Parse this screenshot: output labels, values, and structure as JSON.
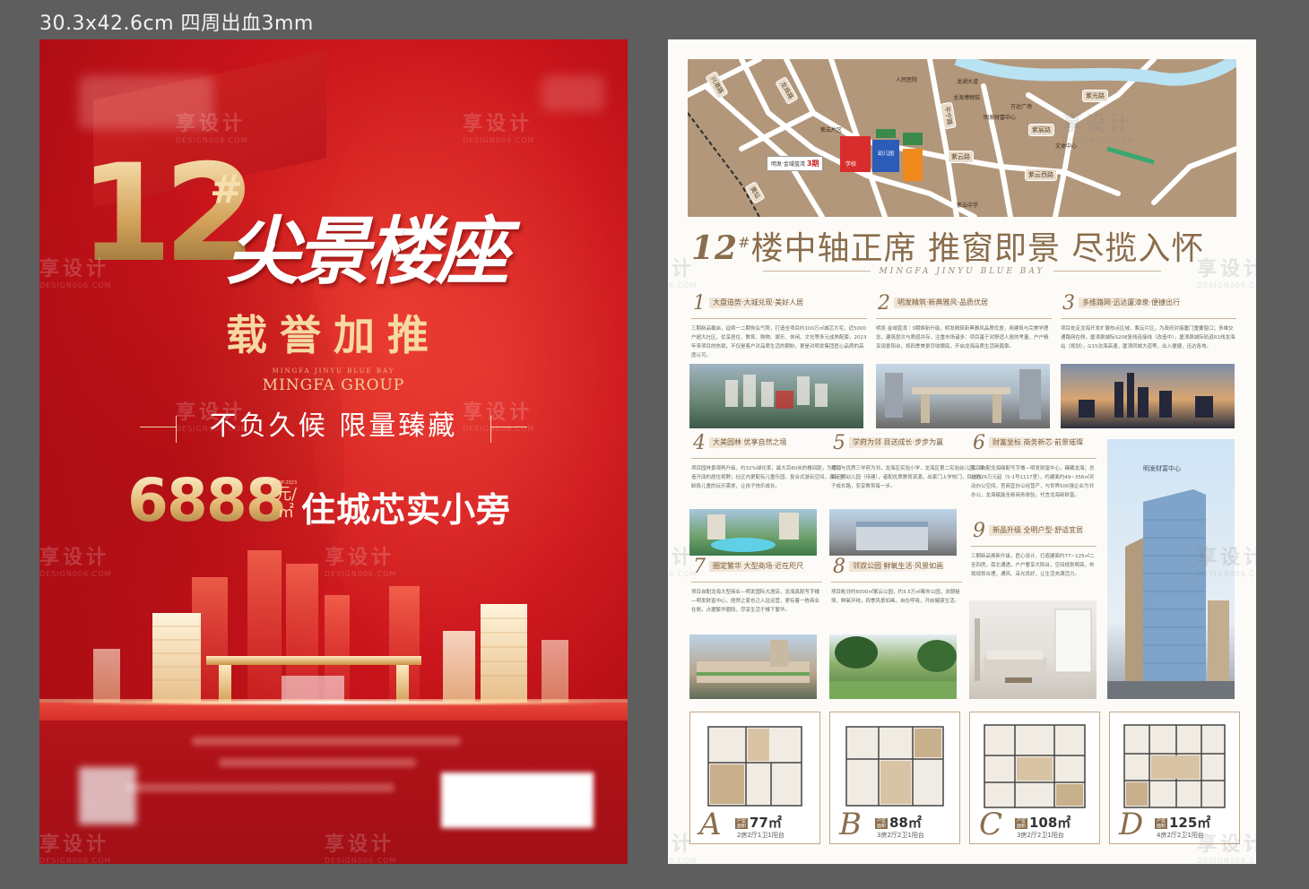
{
  "spec_label": "30.3x42.6cm 四周出血3mm",
  "watermark": {
    "cn": "享设计",
    "en": "DESIGN006.COM"
  },
  "front": {
    "big_number": "12",
    "hash": "#",
    "headline": "尖景楼座",
    "subtitle": "载誉加推",
    "brand_en_small": "MINGFA JINYU BLUE BAY",
    "brand_en": "MINGFA GROUP",
    "slogan": "不负久候  限量臻藏",
    "price": "6888",
    "price_unit": "元/㎡",
    "price_unit_small": "TOP·2023",
    "price_line": "住城芯实小旁",
    "colors": {
      "red": "#c8131a",
      "gold": "#e0b36b"
    }
  },
  "back": {
    "map": {
      "roads": [
        "兴港路",
        "龙商路",
        "平宁路",
        "紫云路",
        "紫光路",
        "紫宸路",
        "紫云西路",
        "黄坛"
      ],
      "places": [
        "紫云片区",
        "人民医院",
        "龙海博物馆",
        "明发财富中心",
        "文体中心",
        "万达广场",
        "学校",
        "龙湖大道",
        "紫云中学",
        "幼儿园",
        "明发·金域蓝湾"
      ],
      "project_label": "明发·金域蓝湾",
      "phase_label": "3期"
    },
    "headline_num": "12",
    "headline_hash": "#",
    "headline_text": "楼中轴正席 推窗即景 尽揽入怀",
    "headline_en": "MINGFA JINYU BLUE BAY",
    "features": [
      {
        "num": "1",
        "title": "大盘造势·大城兑现·美好人居",
        "body": "三期新品载启，延续一二期恢弘气势，打造全项目约100万㎡城芯大宅，近5000户超大社区，优享居住、教育、购物、娱乐、休闲、文化等多元成熟配套，2023年来项目的热销，不仅是客户对品质生活的期盼，更是对明发集团匠心品质的高度认可。"
      },
      {
        "num": "2",
        "title": "明发精筑·新典雅风·品质优居",
        "body": "明发·金域蓝湾｜3期焕新升级，明发精筑新典雅风品质优居，用建筑与完美学理念，建筑层次与质感并存，注重市场诸多：项目基于对舒适人居的考量，户户精享阔景阳台，将四季美景尽收眼底，开启龙海品质生活新篇章。"
      },
      {
        "num": "3",
        "title": "多维路网·迅达厦漳泉·便捷出行",
        "body": "项目处定龙海开发扩展热点区域，紫云片区，为政府对接厦门重要窗口；多维交通路网在侧，厦漳泉城际S208复线连接线（改造中），厦漳泉城际轨道R1线龙海站（规划），G15沈海高速，厦漳同城大道等，出入便捷，迅达各地。"
      },
      {
        "num": "4",
        "title": "大美园林 优享自然之境",
        "body": "项目园林景观再升级，约32%绿化率，最大百80米的楼间距，为您打造开阔的居住视野；社区内更配有儿童乐园，复合式游玩空间，满足全龄段儿童的玩乐需求，让孩子快乐成长。"
      },
      {
        "num": "5",
        "title": "学府为邻 目送成长·步步为赢",
        "body": "项目与优质三学府为邻，龙海区实验小学，龙海区第二实验幼儿园，项目三期幼儿园（待建），者配优质教育资源，出家门上学校门，目送孩子成长路，安享教育每一步。"
      },
      {
        "num": "6",
        "title": "财富坐标 商务新芯·前景璀璨",
        "body": "项目自配龙海鼎配写字楼—明发财富中心，臻藏龙海；总价约26万元起（5-1号1117室），约建面约49~356㎡灵动办公空间，官商宜办公经营产，与世界500强企业为邻办公，龙海赋能全新商务体验，代言龙海新财富。"
      },
      {
        "num": "7",
        "title": "圈定繁华 大型商场·近在咫尺",
        "body": "项目自配龙海大型商业—明发国际大酒店，龙海真配写字楼—明发财富中心，居然之家也己入驻运营，更有着一栋商业在侧，占据繁华圈段，尽享生活于楼下繁华。"
      },
      {
        "num": "8",
        "title": "邻双公园 鲜氧生活·风景如画",
        "body": "项目毗邻约6000㎡紫云公园，约3.5万㎡都市公园，浓荫秘境，鲜氧环绕，四季风景如画，自在呼吸，开启健康生活。"
      },
      {
        "num": "9",
        "title": "新品升级 全明户型·舒适宜居",
        "body": "三期新品焕新升级，匠心设计，打造建面约77~125㎡二至四房，南北通透，户户奢享大阳台，空间规划明亮，布局规划合理，通风、采光良好，让生活充满活力。"
      }
    ],
    "tower_label": "明发财富中心",
    "plans": [
      {
        "letter": "A",
        "tag": "户型面积",
        "area": "77㎡",
        "desc": "2房2厅1卫1阳台"
      },
      {
        "letter": "B",
        "tag": "户型面积",
        "area": "88㎡",
        "desc": "3房2厅2卫1阳台"
      },
      {
        "letter": "C",
        "tag": "户型面积",
        "area": "108㎡",
        "desc": "3房2厅2卫1阳台"
      },
      {
        "letter": "D",
        "tag": "户型面积",
        "area": "125㎡",
        "desc": "4房2厅2卫1阳台"
      }
    ]
  }
}
